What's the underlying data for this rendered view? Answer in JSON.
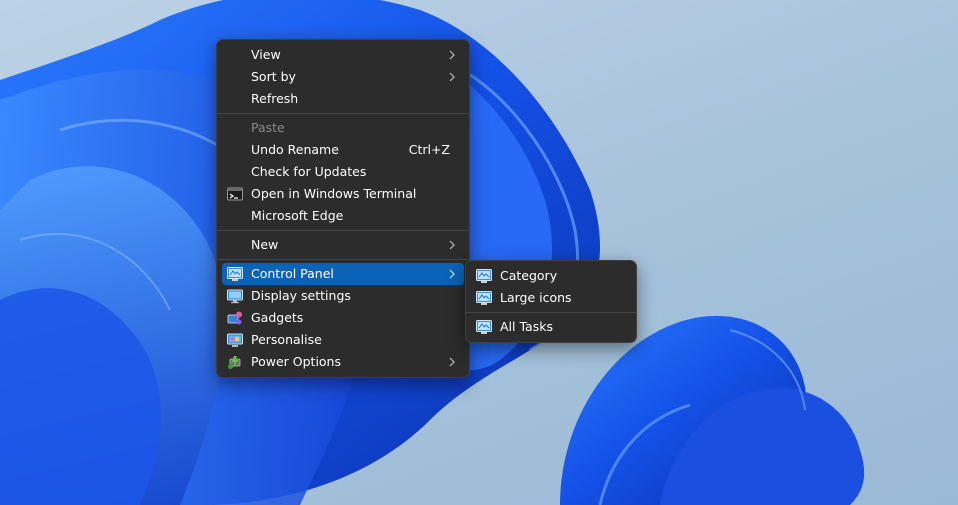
{
  "context_menu": {
    "groups": [
      [
        {
          "label": "View",
          "submenu": true
        },
        {
          "label": "Sort by",
          "submenu": true
        },
        {
          "label": "Refresh"
        }
      ],
      [
        {
          "label": "Paste",
          "disabled": true
        },
        {
          "label": "Undo Rename",
          "shortcut": "Ctrl+Z"
        },
        {
          "label": "Check for Updates"
        },
        {
          "label": "Open in Windows Terminal",
          "icon": "terminal-icon"
        },
        {
          "label": "Microsoft Edge"
        }
      ],
      [
        {
          "label": "New",
          "submenu": true
        }
      ],
      [
        {
          "label": "Control Panel",
          "icon": "control-panel-icon",
          "submenu": true,
          "highlighted": true
        },
        {
          "label": "Display settings",
          "icon": "display-settings-icon"
        },
        {
          "label": "Gadgets",
          "icon": "gadgets-icon"
        },
        {
          "label": "Personalise",
          "icon": "personalise-icon"
        },
        {
          "label": "Power Options",
          "icon": "power-options-icon",
          "submenu": true
        }
      ]
    ]
  },
  "control_panel_submenu": {
    "items": [
      {
        "label": "Category",
        "icon": "control-panel-icon"
      },
      {
        "label": "Large icons",
        "icon": "control-panel-icon"
      },
      {
        "label": "All Tasks",
        "icon": "control-panel-icon"
      }
    ]
  },
  "colors": {
    "menu_bg": "#2c2c2c",
    "highlight": "#0b63b8",
    "wallpaper_blue": "#1e5ff0"
  }
}
